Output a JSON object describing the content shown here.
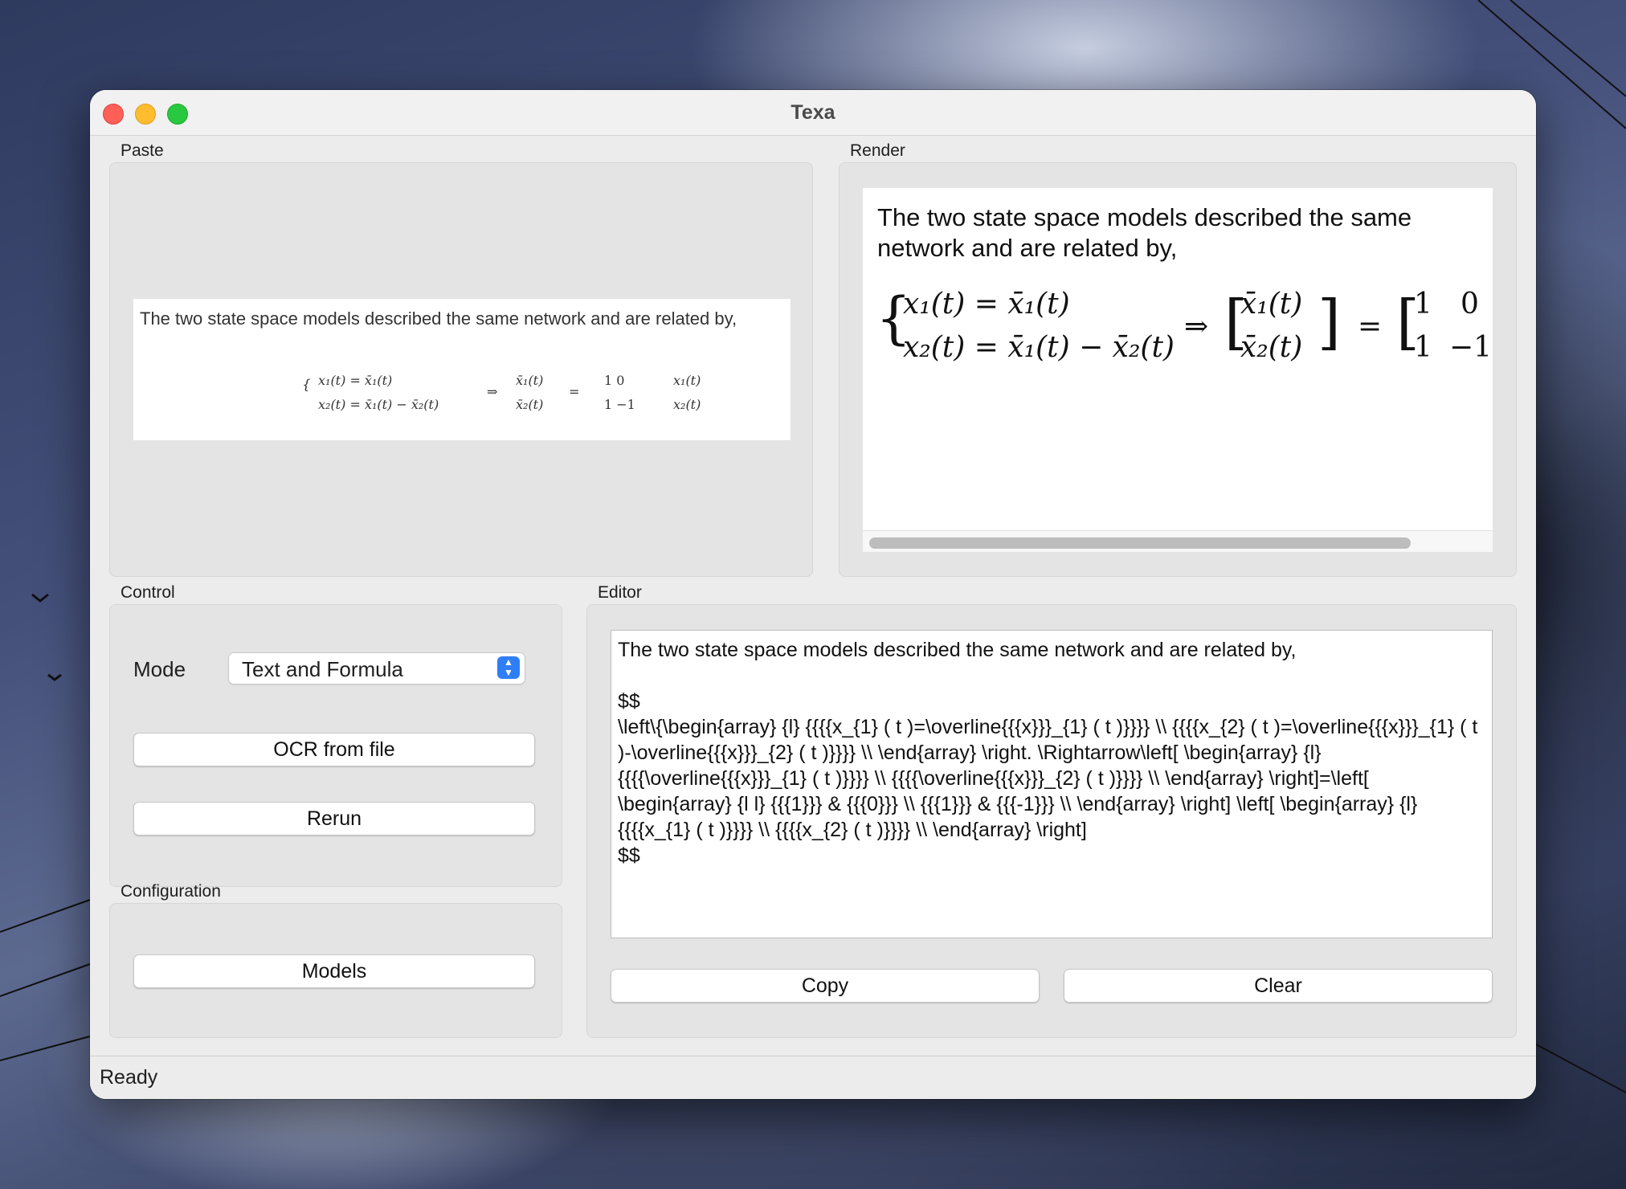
{
  "window": {
    "title": "Texa"
  },
  "paste": {
    "label": "Paste",
    "image_text": "The two state space models described the same network and are related by,",
    "math_line1": "x₁(t) = x̄₁(t)",
    "math_line2": "x₂(t) = x̄₁(t) − x̄₂(t)",
    "math_rest": "⇒",
    "mat_a1": "x̄₁(t)",
    "mat_a2": "x̄₂(t)",
    "mat_b1": "1    0",
    "mat_b2": "1   −1",
    "mat_c1": "x₁(t)",
    "mat_c2": "x₂(t)"
  },
  "render": {
    "label": "Render",
    "text": "The two state space models described the same network and are related by,",
    "math_line1": "x₁(t) = x̄₁(t)",
    "math_line2": "x₂(t) = x̄₁(t) − x̄₂(t)",
    "arrow": "⇒",
    "vec1": "x̄₁(t)",
    "vec2": "x̄₂(t)",
    "equals": "=",
    "m11": "1",
    "m12": "0",
    "m21": "1",
    "m22": "−1"
  },
  "control": {
    "label": "Control",
    "mode_label": "Mode",
    "mode_value": "Text and Formula",
    "ocr_button": "OCR from file",
    "rerun_button": "Rerun"
  },
  "configuration": {
    "label": "Configuration",
    "models_button": "Models"
  },
  "editor": {
    "label": "Editor",
    "content": "The two state space models described the same network and are related by,\n\n$$\n\\left\\{\\begin{array} {l} {{{{x_{1} ( t )=\\overline{{{x}}}_{1} ( t )}}}} \\\\ {{{{x_{2} ( t )=\\overline{{{x}}}_{1} ( t )-\\overline{{{x}}}_{2} ( t )}}}} \\\\ \\end{array} \\right. \\Rightarrow\\left[ \\begin{array} {l} {{{{\\overline{{{x}}}_{1} ( t )}}}} \\\\ {{{{\\overline{{{x}}}_{2} ( t )}}}} \\\\ \\end{array} \\right]=\\left[ \\begin{array} {l l} {{{1}}} & {{{0}}} \\\\ {{{1}}} & {{{-1}}} \\\\ \\end{array} \\right] \\left[ \\begin{array} {l} {{{{x_{1} ( t )}}}} \\\\ {{{{x_{2} ( t )}}}} \\\\ \\end{array} \\right]\n$$",
    "copy_button": "Copy",
    "clear_button": "Clear"
  },
  "status": {
    "text": "Ready"
  }
}
